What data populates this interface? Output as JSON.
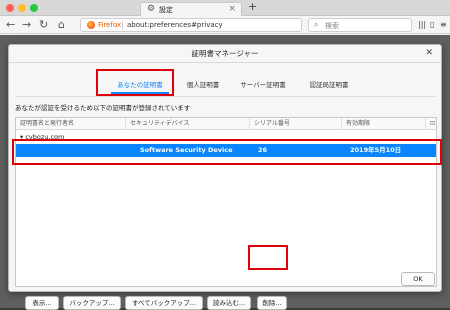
{
  "browser": {
    "tab_title": "設定",
    "url_brand": "Firefox",
    "url": "about:preferences#privacy",
    "search_placeholder": "検索"
  },
  "dialog": {
    "title": "証明書マネージャー",
    "tabs": [
      {
        "label": "あなたの証明書",
        "active": true
      },
      {
        "label": "個人証明書",
        "active": false
      },
      {
        "label": "サーバー証明書",
        "active": false
      },
      {
        "label": "認証局証明書",
        "active": false
      }
    ],
    "description": "あなたが認証を受けるため以下の証明書が登録されています",
    "table": {
      "columns": [
        "証明書名と発行者名",
        "セキュリティデバイス",
        "シリアル番号",
        "有効期限"
      ],
      "group": "cybozu.com",
      "rows": [
        {
          "name": "",
          "device": "Software Security Device",
          "serial": "26",
          "expires": "2019年5月10日"
        }
      ]
    },
    "buttons": {
      "view": "表示...",
      "backup": "バックアップ...",
      "backup_all": "すべてバックアップ...",
      "import": "読み込む...",
      "delete": "削除...",
      "ok": "OK"
    }
  }
}
